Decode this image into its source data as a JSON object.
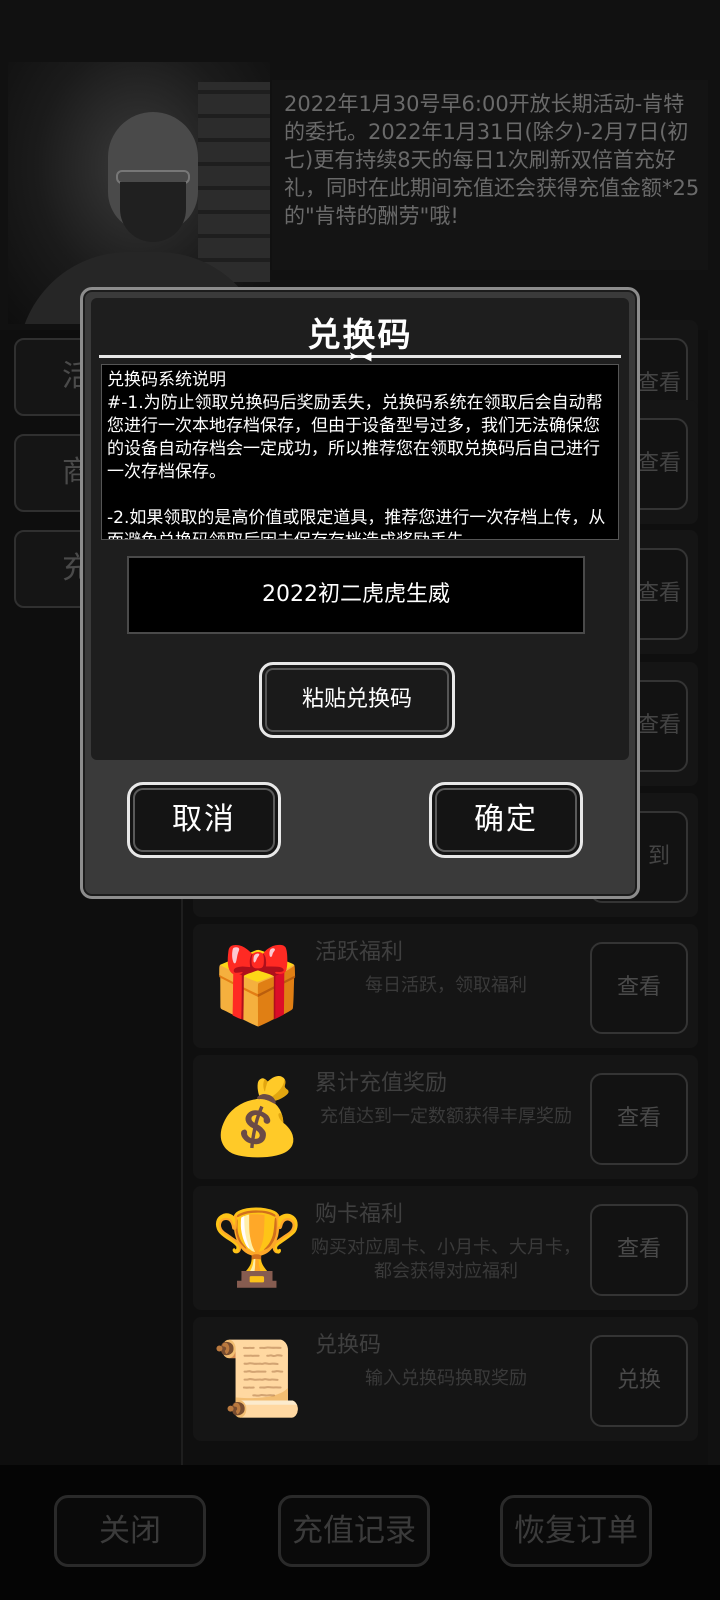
{
  "background": {
    "notice_text": "2022年1月30号早6:00开放长期活动-肯特的委托。2022年1月31日(除夕)-2月7日(初七)更有持续8天的每日1次刷新双倍首充好礼，同时在此期间充值还会获得充值金额*25的\"肯特的酬劳\"哦!",
    "left_tabs": [
      "活",
      "商",
      "充"
    ],
    "partial_buttons": [
      "查看",
      "查看",
      "查看",
      "查看",
      "查看",
      "到"
    ],
    "rows": [
      {
        "icon": "gift-icon",
        "title": "活跃福利",
        "desc": "每日活跃，领取福利",
        "button": "查看"
      },
      {
        "icon": "money-bag-icon",
        "title": "累计充值奖励",
        "desc": "充值达到一定数额获得丰厚奖励",
        "button": "查看"
      },
      {
        "icon": "trophy-card-icon",
        "title": "购卡福利",
        "desc": "购买对应周卡、小月卡、大月卡，都会获得对应福利",
        "button": "查看"
      },
      {
        "icon": "scroll-icon",
        "title": "兑换码",
        "desc": "输入兑换码换取奖励",
        "button": "兑换"
      }
    ],
    "bottom_buttons": {
      "close": "关闭",
      "recharge_history": "充值记录",
      "restore_order": "恢复订单"
    }
  },
  "dialog": {
    "title": "兑换码",
    "description": {
      "heading": "兑换码系统说明",
      "para1": "#-1.为防止领取兑换码后奖励丢失，兑换码系统在领取后会自动帮您进行一次本地存档保存，但由于设备型号过多，我们无法确保您的设备自动存档会一定成功，所以推荐您在领取兑换码后自己进行一次存档保存。",
      "para2": "-2.如果领取的是高价值或限定道具，推荐您进行一次存档上传，从而避免兑换码领取后因未保存存档造成奖励丢失。"
    },
    "code_value": "2022初二虎虎生威",
    "paste_label": "粘贴兑换码",
    "cancel_label": "取消",
    "confirm_label": "确定"
  }
}
